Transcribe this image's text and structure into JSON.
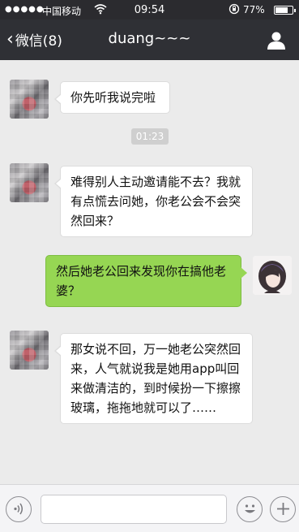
{
  "status_bar": {
    "signal_dots": "●●●●●",
    "carrier": "中国移动",
    "time": "09:54",
    "battery_percent_label": "77%",
    "battery_level": 0.77
  },
  "nav": {
    "back_label": "微信(8)",
    "title": "duang~~~"
  },
  "messages": [
    {
      "side": "left",
      "text": "你先听我说完啦"
    },
    {
      "side": "left",
      "text": "难得别人主动邀请能不去？我就有点慌去问她，你老公会不会突然回来？"
    },
    {
      "side": "right",
      "text": "然后她老公回来发现你在搞他老婆？"
    },
    {
      "side": "left",
      "text": "那女说不回，万一她老公突然回来，人气就说我是她用app叫回来做清洁的，到时候扮一下擦擦玻璃，拖拖地就可以了……"
    }
  ],
  "timestamp": "01:23",
  "colors": {
    "nav_bg": "#2f3035",
    "status_bg": "#2b2b2f",
    "chat_bg": "#ebebeb",
    "bubble_left": "#ffffff",
    "bubble_right": "#96d653"
  },
  "icons": {
    "back": "chevron-left-icon",
    "profile": "person-icon",
    "voice": "voice-icon",
    "emoji": "smiley-icon",
    "add": "plus-icon"
  }
}
